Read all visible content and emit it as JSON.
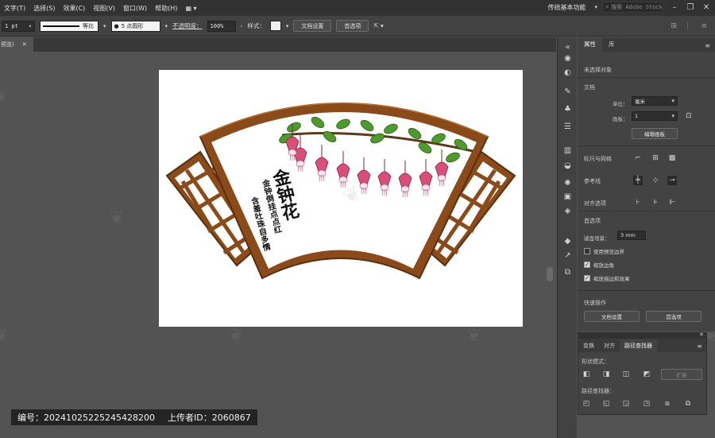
{
  "menubar": {
    "items": [
      "文字(T)",
      "选择(S)",
      "效果(C)",
      "视图(V)",
      "窗口(W)",
      "帮助(H)"
    ],
    "workspace": "传统基本功能",
    "search_placeholder": "搜索 Adobe Stock"
  },
  "controlbar": {
    "stroke_weight": "1 pt",
    "stroke_profile": "等比",
    "brush": "5 点圆形",
    "opacity_label": "不透明度：",
    "opacity_value": "100%",
    "style_label": "样式：",
    "doc_setup_btn": "文档设置",
    "prefs_btn": "首选项"
  },
  "doc_tab": {
    "label": "预览)"
  },
  "artwork": {
    "title": "金钟花",
    "poem_line1": "金钟倒挂点点红",
    "poem_line2": "含羞吐珠自多情",
    "colors": {
      "frame_dark": "#5a2e0e",
      "frame_mid": "#8a4a1a",
      "frame_light": "#b9712c",
      "leaf": "#4f9a2e",
      "flower": "#d8507a"
    }
  },
  "properties_panel": {
    "tabs": [
      "属性",
      "库"
    ],
    "no_selection": "未选择对象",
    "doc_section": "文档",
    "units_label": "单位：",
    "units_value": "毫米",
    "artboard_label": "画板：",
    "artboard_value": "1",
    "edit_artboard_btn": "编辑画板",
    "rulers_grids": "标尺与网格",
    "guides": "参考线",
    "snap_options": "对齐选项",
    "prefs_section": "首选项",
    "keyboard_inc_label": "键盘增量：",
    "keyboard_inc_value": "3 mm",
    "use_preview_bounds": "使用预览边界",
    "scale_corners": "缩放边角",
    "scale_strokes": "缩放描边和效果",
    "quick_actions": "快速操作",
    "quick_doc_setup": "文档设置",
    "quick_prefs": "首选项"
  },
  "pathfinder_panel": {
    "tabs": [
      "变换",
      "对齐",
      "路径查找器"
    ],
    "shape_modes": "形状模式：",
    "expand_btn": "扩展",
    "pathfinders": "路径查找器："
  },
  "caption": {
    "id_text": "编号：20241025225245428200",
    "uploader_text": "上传者ID：2060867"
  }
}
